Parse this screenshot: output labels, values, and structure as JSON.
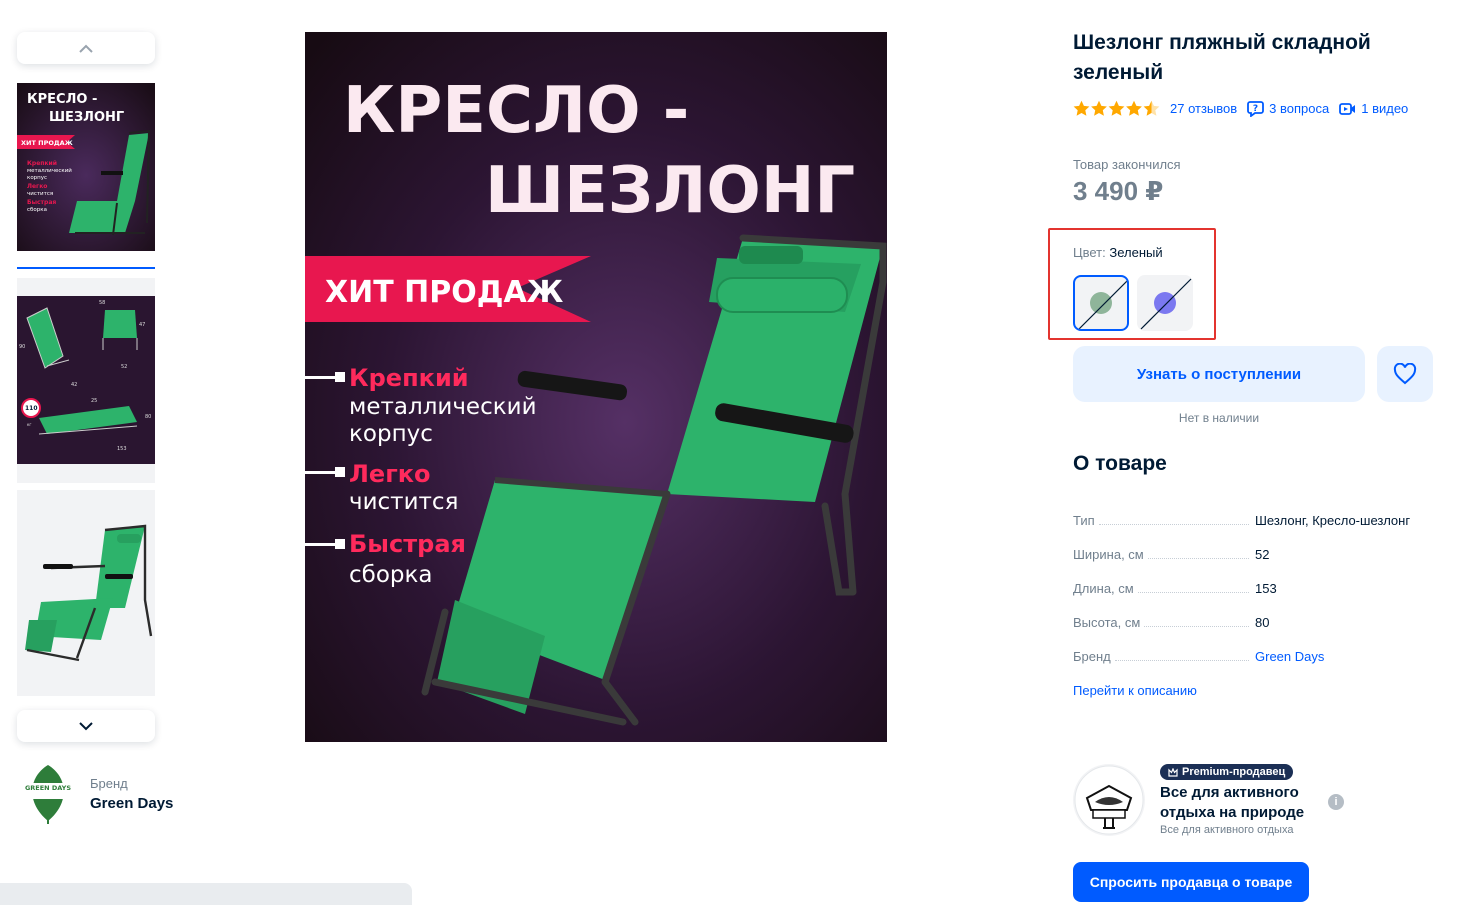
{
  "product": {
    "title": "Шезлонг пляжный складной зеленый",
    "rating_stars": 4.5,
    "reviews": "27 отзывов",
    "questions": "3 вопроса",
    "videos": "1 видео",
    "out_of_stock_label": "Товар закончился",
    "price": "3 490 ₽"
  },
  "color": {
    "label": "Цвет:",
    "value": "Зеленый",
    "swatches": [
      {
        "name": "Зеленый",
        "hex": "#8fb59a",
        "selected": true
      },
      {
        "name": "Синий",
        "hex": "#7b78f0",
        "selected": false
      }
    ]
  },
  "actions": {
    "notify": "Узнать о поступлении",
    "stock_note": "Нет в наличии",
    "ask_seller": "Спросить продавца о товаре"
  },
  "about": {
    "title": "О товаре",
    "specs": [
      {
        "key": "Тип",
        "value": "Шезлонг, Кресло-шезлонг"
      },
      {
        "key": "Ширина, см",
        "value": "52"
      },
      {
        "key": "Длина, см",
        "value": "153"
      },
      {
        "key": "Высота, см",
        "value": "80"
      },
      {
        "key": "Бренд",
        "value": "Green Days"
      }
    ],
    "description_link": "Перейти к описанию"
  },
  "seller": {
    "badge": "Premium-продавец",
    "name": "Все для активного отдыха на природе",
    "subtitle": "Все для активного отдыха"
  },
  "brand": {
    "caption": "Бренд",
    "name": "Green Days",
    "logo_text": "GREEN DAYS"
  },
  "main_image": {
    "headline_1": "КРЕСЛО -",
    "headline_2": "ШЕЗЛОНГ",
    "banner": "ХИТ ПРОДАЖ",
    "features": [
      {
        "accent": "Крепкий",
        "lines": [
          "металлический",
          "корпус"
        ]
      },
      {
        "accent": "Легко",
        "lines": [
          "чистится"
        ]
      },
      {
        "accent": "Быстрая",
        "lines": [
          "сборка"
        ]
      }
    ]
  },
  "thumb_1": {
    "headline_1": "КРЕСЛО -",
    "headline_2": "ШЕЗЛОНГ",
    "banner": "ХИТ ПРОДАЖ",
    "f1a": "Крепкий",
    "f1b": "металлический",
    "f1c": "корпус",
    "f2a": "Легко",
    "f2b": "чистится",
    "f3a": "Быстрая",
    "f3b": "сборка"
  },
  "thumb_2": {
    "dims": [
      "58",
      "42",
      "90",
      "52",
      "47",
      "153",
      "80",
      "25"
    ],
    "load": "110",
    "load_unit": "кг"
  },
  "colors": {
    "accent": "#005bff",
    "image_bg": "#1e1018",
    "banner": "#e8174f",
    "chair": "#2db36b"
  }
}
